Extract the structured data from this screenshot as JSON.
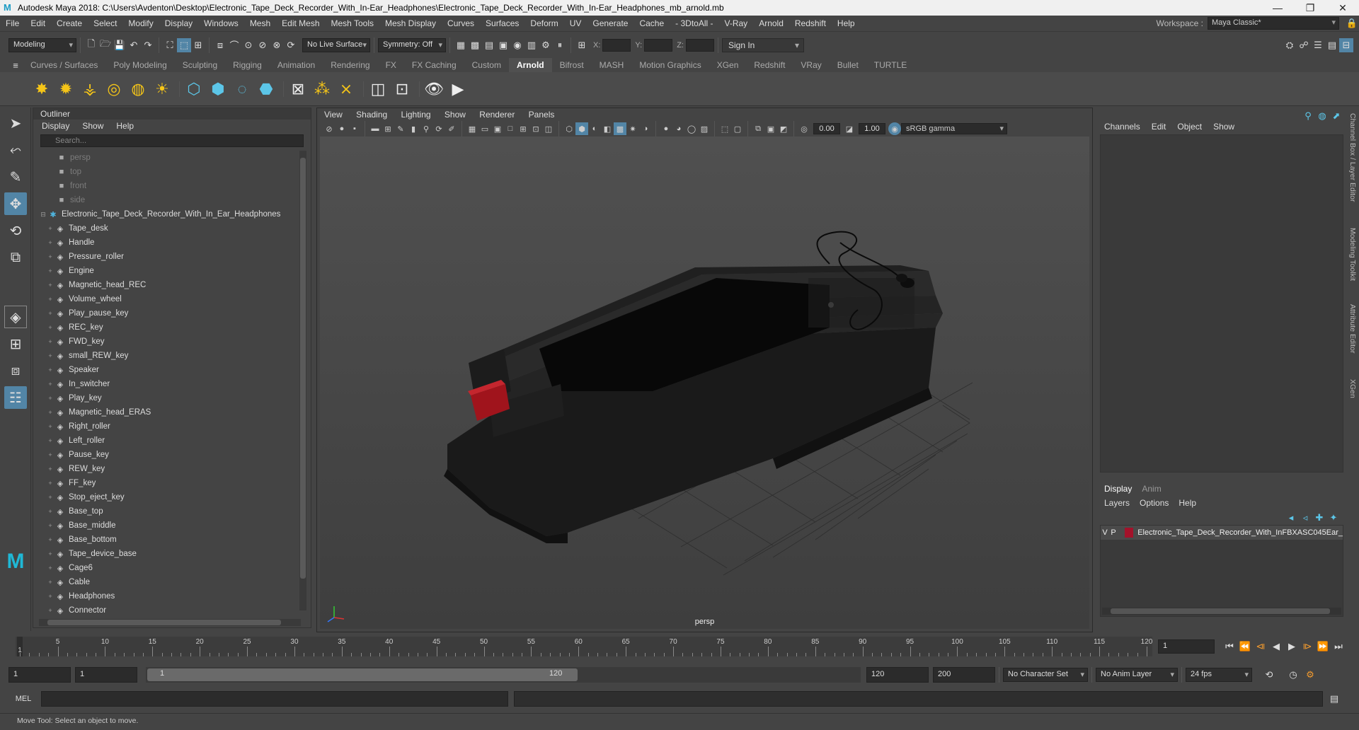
{
  "window": {
    "title": "Autodesk Maya 2018: C:\\Users\\Avdenton\\Desktop\\Electronic_Tape_Deck_Recorder_With_In-Ear_Headphones\\Electronic_Tape_Deck_Recorder_With_In-Ear_Headphones_mb_arnold.mb",
    "logo": "M",
    "minimize": "—",
    "maximize": "❐",
    "close": "✕"
  },
  "menubar": {
    "items": [
      "File",
      "Edit",
      "Create",
      "Select",
      "Modify",
      "Display",
      "Windows",
      "Mesh",
      "Edit Mesh",
      "Mesh Tools",
      "Mesh Display",
      "Curves",
      "Surfaces",
      "Deform",
      "UV",
      "Generate",
      "Cache",
      "- 3DtoAll -",
      "V-Ray",
      "Arnold",
      "Redshift",
      "Help"
    ],
    "workspace_label": "Workspace :",
    "workspace_value": "Maya Classic*"
  },
  "statusline": {
    "mode": "Modeling",
    "live_surface": "No Live Surface",
    "symmetry": "Symmetry: Off",
    "x_label": "X:",
    "y_label": "Y:",
    "z_label": "Z:",
    "sign_in": "Sign In"
  },
  "shelf": {
    "tabs": [
      "Curves / Surfaces",
      "Poly Modeling",
      "Sculpting",
      "Rigging",
      "Animation",
      "Rendering",
      "FX",
      "FX Caching",
      "Custom",
      "Arnold",
      "Bifrost",
      "MASH",
      "Motion Graphics",
      "XGen",
      "Redshift",
      "VRay",
      "Bullet",
      "TURTLE"
    ],
    "active_tab": "Arnold"
  },
  "outliner": {
    "title": "Outliner",
    "menu": [
      "Display",
      "Show",
      "Help"
    ],
    "search_placeholder": "Search...",
    "cameras": [
      "persp",
      "top",
      "front",
      "side"
    ],
    "root": "Electronic_Tape_Deck_Recorder_With_In_Ear_Headphones",
    "children": [
      "Tape_desk",
      "Handle",
      "Pressure_roller",
      "Engine",
      "Magnetic_head_REC",
      "Volume_wheel",
      "Play_pause_key",
      "REC_key",
      "FWD_key",
      "small_REW_key",
      "Speaker",
      "In_switcher",
      "Play_key",
      "Magnetic_head_ERAS",
      "Right_roller",
      "Left_roller",
      "Pause_key",
      "REW_key",
      "FF_key",
      "Stop_eject_key",
      "Base_top",
      "Base_middle",
      "Base_bottom",
      "Tape_device_base",
      "Cage6",
      "Cable",
      "Headphones",
      "Connector"
    ]
  },
  "viewport": {
    "menu": [
      "View",
      "Shading",
      "Lighting",
      "Show",
      "Renderer",
      "Panels"
    ],
    "exposure": "0.00",
    "gamma": "1.00",
    "color_space": "sRGB gamma",
    "camera": "persp"
  },
  "channelbox": {
    "menu": [
      "Channels",
      "Edit",
      "Object",
      "Show"
    ],
    "tabs": [
      "Display",
      "Anim"
    ],
    "layer_menu": [
      "Layers",
      "Options",
      "Help"
    ],
    "layer": {
      "v": "V",
      "p": "P",
      "name": "Electronic_Tape_Deck_Recorder_With_InFBXASC045Ear_",
      "color": "#a3122a"
    },
    "side_tabs": [
      "Channel Box / Layer Editor",
      "Modeling Toolkit",
      "Attribute Editor",
      "XGen"
    ]
  },
  "timeline": {
    "ticks": [
      "5",
      "10",
      "15",
      "20",
      "25",
      "30",
      "35",
      "40",
      "45",
      "50",
      "55",
      "60",
      "65",
      "70",
      "75",
      "80",
      "85",
      "90",
      "95",
      "100",
      "105",
      "110",
      "115",
      "120"
    ],
    "start_label": "1",
    "current_frame": "1"
  },
  "range": {
    "start": "1",
    "playback_start": "1",
    "slider_start": "1",
    "slider_end": "120",
    "playback_end": "120",
    "end": "200",
    "character_set": "No Character Set",
    "anim_layer": "No Anim Layer",
    "fps": "24 fps"
  },
  "cmdline": {
    "label": "MEL"
  },
  "helpline": {
    "text": "Move Tool: Select an object to move."
  }
}
